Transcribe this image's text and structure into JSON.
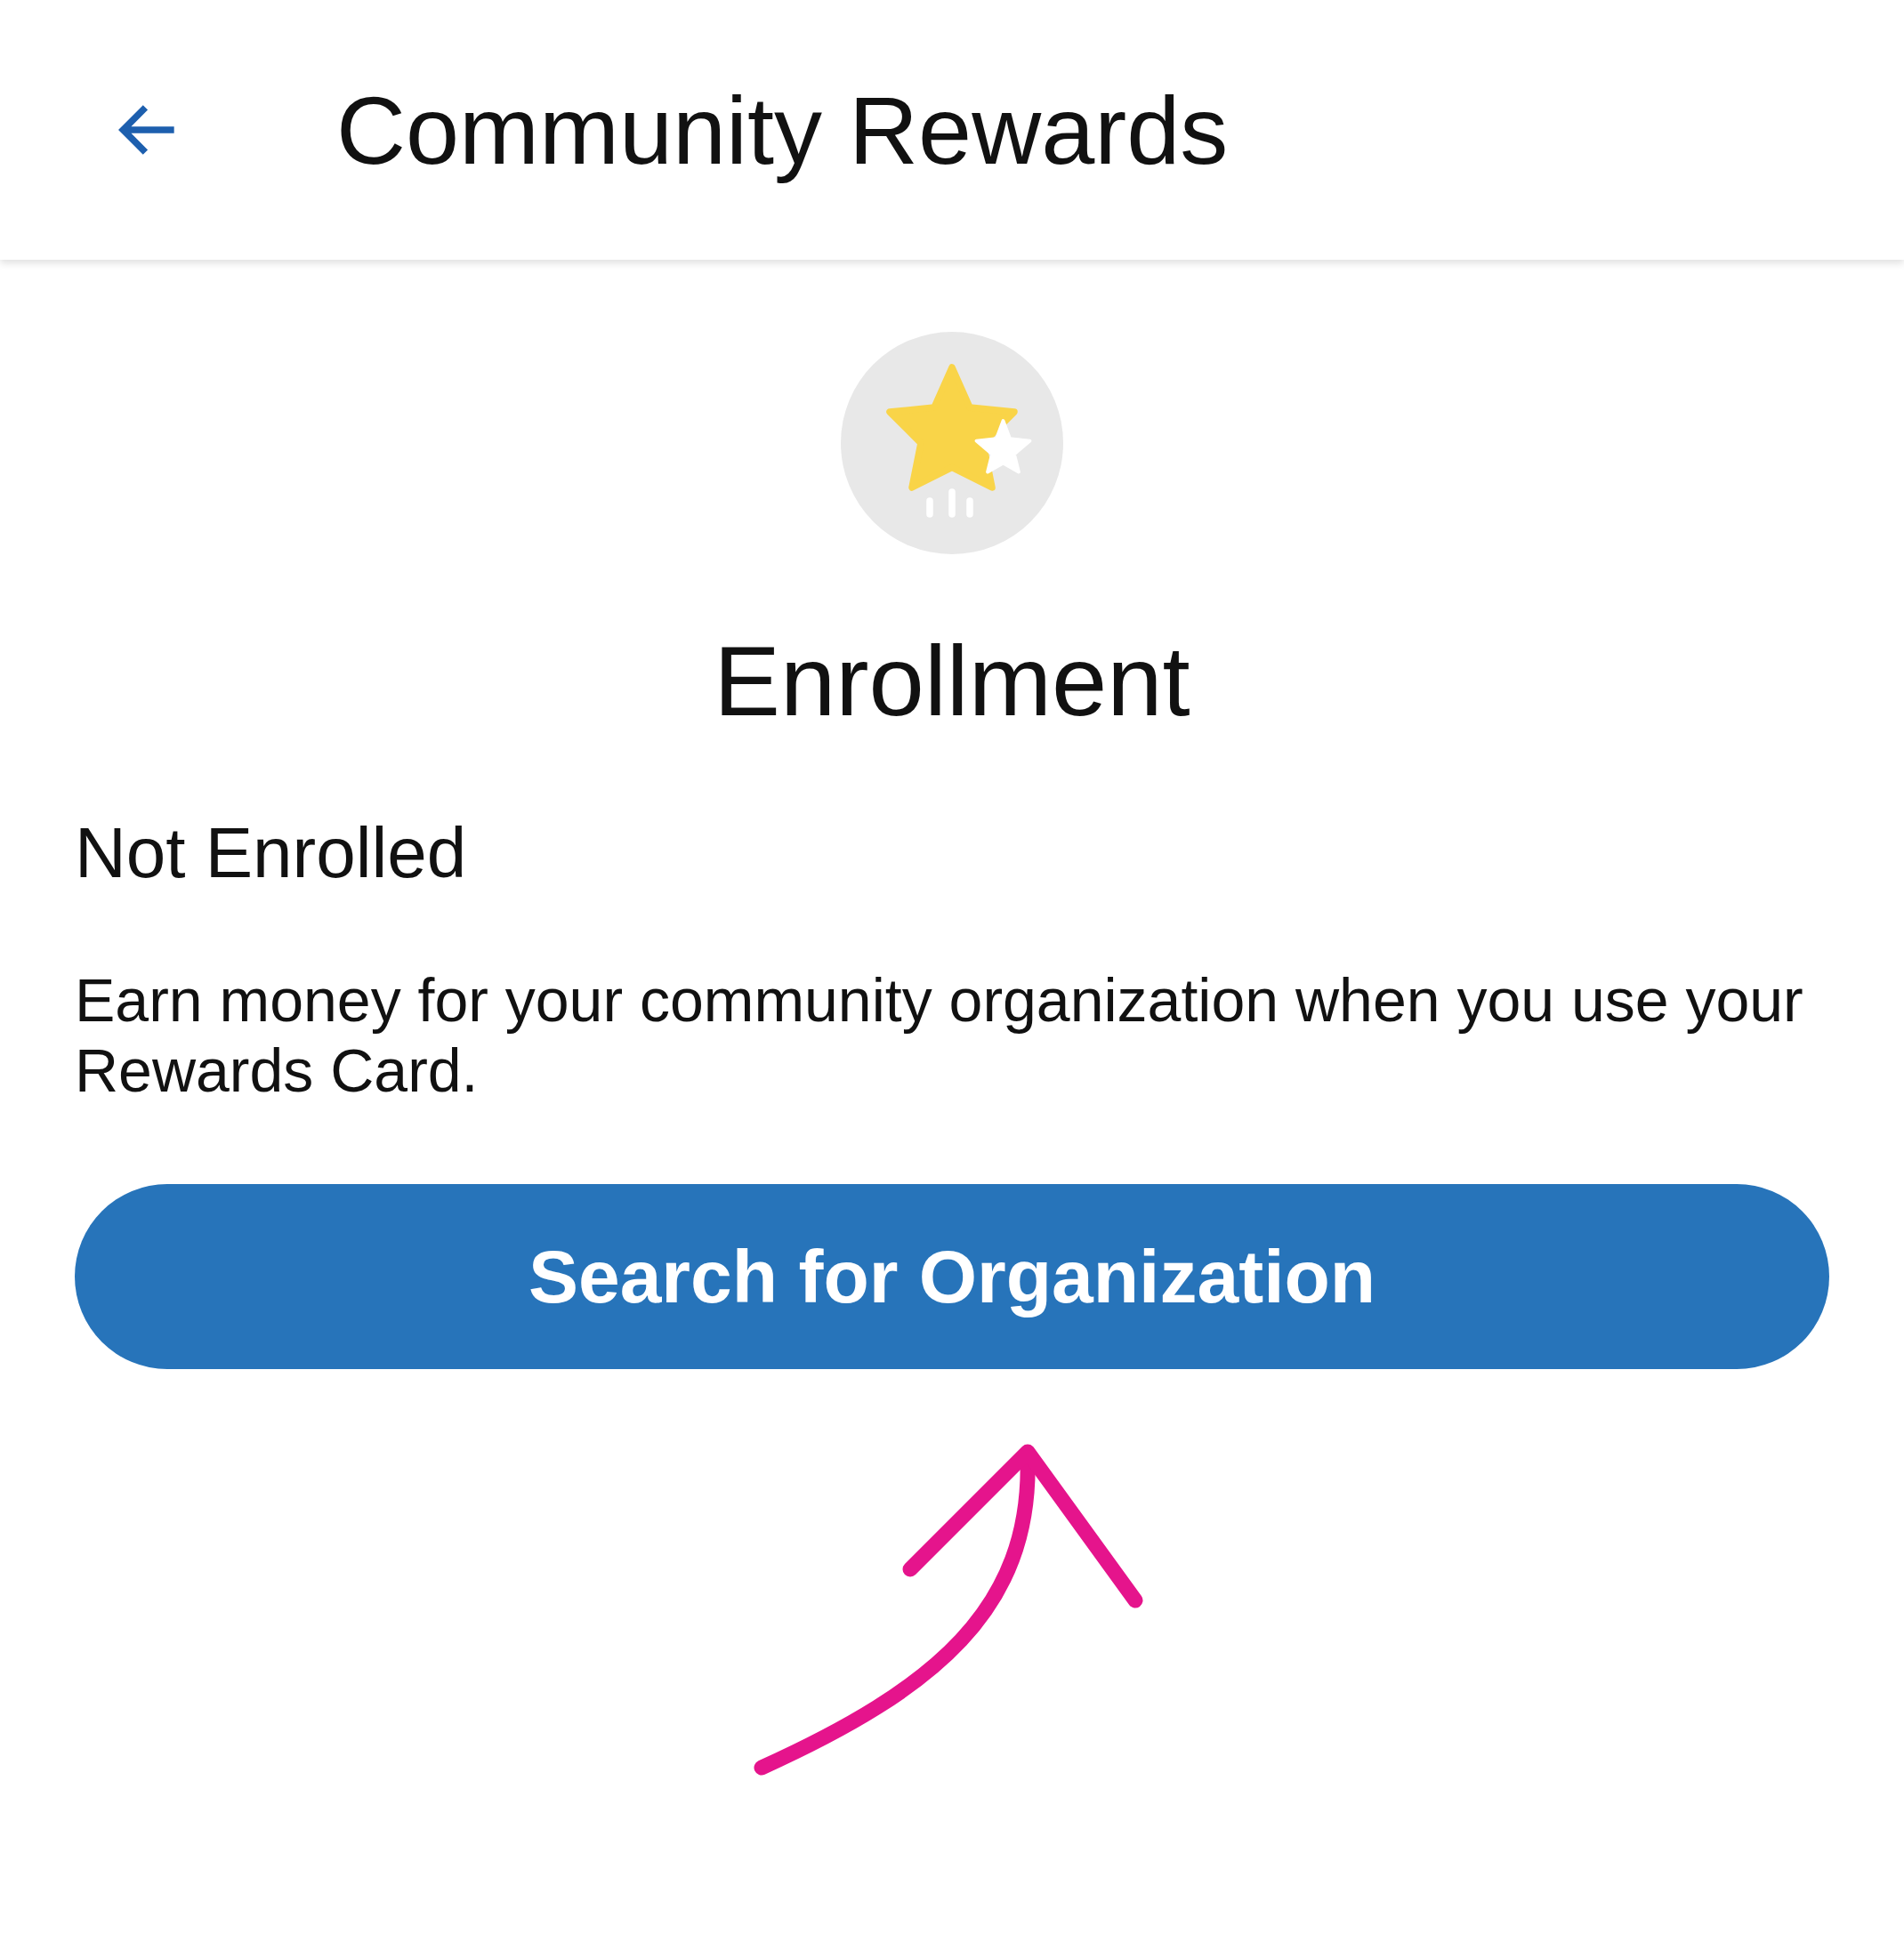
{
  "header": {
    "title": "Community Rewards"
  },
  "section": {
    "heading": "Enrollment",
    "status": "Not Enrolled",
    "description": "Earn money for your community organization when you use your Rewards Card."
  },
  "button": {
    "label": "Search for Organization"
  },
  "annotation": {
    "kind": "arrow"
  }
}
